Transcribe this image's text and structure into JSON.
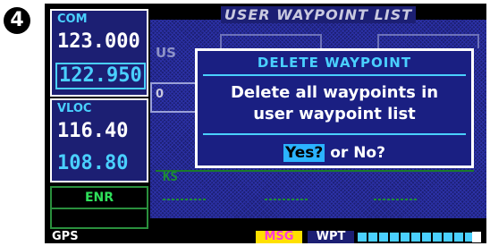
{
  "step_number": "4",
  "page": {
    "title": "USER WAYPOINT LIST",
    "bg_frag_us": "US",
    "bg_frag_ks": "KS"
  },
  "com": {
    "label": "COM",
    "active": "123.000",
    "standby": "122.950"
  },
  "vloc": {
    "label": "VLOC",
    "active": "116.40",
    "standby": "108.80"
  },
  "mode": {
    "label": "ENR"
  },
  "status_bar": {
    "gps": "GPS",
    "msg": "MSG",
    "wpt": "WPT"
  },
  "dialog": {
    "title": "DELETE WAYPOINT",
    "line1": "Delete all waypoints in",
    "line2": "user waypoint list",
    "yes": "Yes?",
    "or": " or ",
    "no": "No?"
  },
  "colors": {
    "screen_bg": "#000000",
    "panel_bg": "#1c1f73",
    "cyan": "#4ad0ff",
    "green": "#2ee05a",
    "magenta": "#ff3bd4",
    "yellow": "#ffe000"
  }
}
